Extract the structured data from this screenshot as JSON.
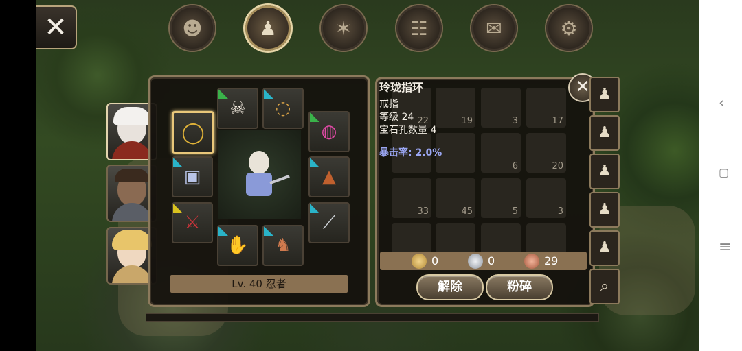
{
  "tabs": [
    {
      "name": "head-tab",
      "icon": "head-silhouette-icon",
      "glyph": "☻"
    },
    {
      "name": "bag-tab",
      "icon": "bag-icon",
      "glyph": "♟"
    },
    {
      "name": "skill-tab",
      "icon": "sword-compass-icon",
      "glyph": "✶"
    },
    {
      "name": "party-tab",
      "icon": "party-icon",
      "glyph": "☷"
    },
    {
      "name": "quest-tab",
      "icon": "scroll-icon",
      "glyph": "✉"
    },
    {
      "name": "settings-tab",
      "icon": "gear-icon",
      "glyph": "⚙"
    }
  ],
  "equipment": {
    "level_label": "Lv. 40 忍者",
    "selected_slot": "ring"
  },
  "inventory_counts": {
    "r1": [
      "22",
      "19",
      "3",
      "17"
    ],
    "r2": [
      "",
      "",
      "6",
      "20"
    ],
    "r3": [
      "33",
      "45",
      "5",
      "3"
    ]
  },
  "tooltip": {
    "name": "玲珑指环",
    "type": "戒指",
    "level": "等级 24",
    "sockets": "宝石孔数量 4",
    "crit": "暴击率: 2.0%"
  },
  "currency": {
    "gold": "0",
    "silver": "0",
    "copper": "29"
  },
  "buttons": {
    "unequip": "解除",
    "shatter": "粉碎",
    "close_x": "✕",
    "close_main": "✕"
  },
  "colors": {
    "rarity_green": "#3ab24a",
    "rarity_cyan": "#2ab3c8",
    "rarity_yellow": "#d9c21f",
    "selected_border": "#e9c77a",
    "crit_text": "#9aa6f2"
  }
}
